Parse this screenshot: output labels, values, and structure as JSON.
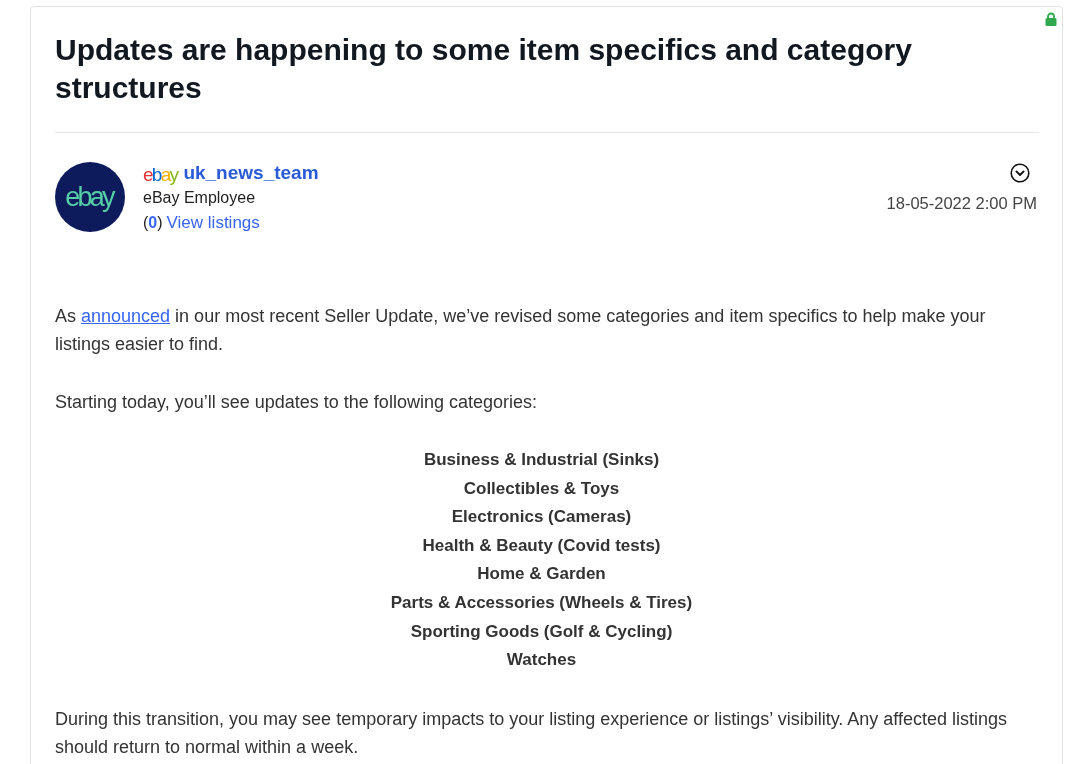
{
  "post": {
    "title": "Updates are happening to some item specifics and category structures",
    "author": {
      "avatar_text": "ebay",
      "logo_text": "ebay",
      "username": "uk_news_team",
      "role": "eBay Employee",
      "listing_count": "(**0**)",
      "listings_link": "View listings"
    },
    "timestamp": "18-05-2022 2:00 PM",
    "body": [
      {
        "kind": "paragraph",
        "segments": [
          {
            "kind": "text",
            "text": "As "
          },
          {
            "kind": "link",
            "text": "announced"
          },
          {
            "kind": "text",
            "text": " in our most recent Seller Update, we’ve revised some categories and item specifics to help make your listings easier to find."
          }
        ]
      },
      {
        "kind": "paragraph",
        "segments": [
          {
            "kind": "text",
            "text": "Starting today, you’ll see updates to the following categories:"
          }
        ]
      },
      {
        "kind": "category_list",
        "items": [
          "Business & Industrial (Sinks)",
          "Collectibles & Toys",
          "Electronics (Cameras)",
          "Health & Beauty (Covid tests)",
          "Home & Garden",
          "Parts & Accessories (Wheels & Tires)",
          "Sporting Goods (Golf & Cycling)",
          "Watches"
        ]
      },
      {
        "kind": "paragraph",
        "segments": [
          {
            "kind": "text",
            "text": "During this transition, you may see temporary impacts to your listing experience or listings’ visibility. Any affected listings should return to normal within a week."
          }
        ]
      }
    ]
  }
}
